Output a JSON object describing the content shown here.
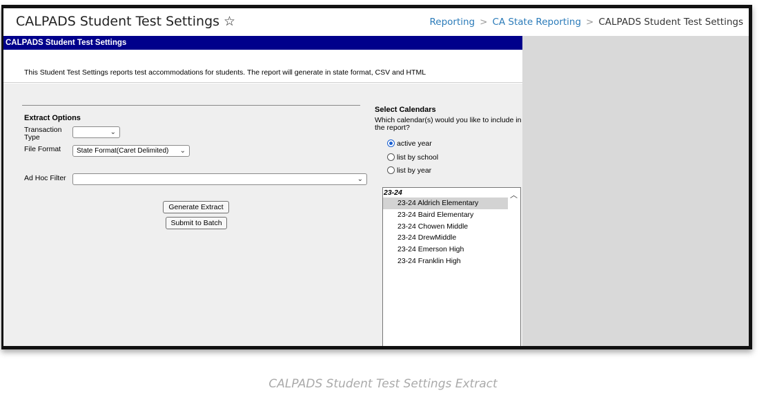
{
  "page": {
    "title": "CALPADS Student Test Settings",
    "star_icon": "star-outline-icon",
    "breadcrumbs": [
      "Reporting",
      "CA State Reporting",
      "CALPADS Student Test Settings"
    ],
    "breadcrumb_separator": ">"
  },
  "panel": {
    "header": "CALPADS Student Test Settings",
    "description": "This Student Test Settings reports test accommodations for students. The report will generate in state format, CSV and HTML"
  },
  "extract": {
    "section_title": "Extract Options",
    "transaction_type_label": "Transaction Type",
    "transaction_type_value": "",
    "file_format_label": "File Format",
    "file_format_value": "State Format(Caret Delimited)",
    "adhoc_label": "Ad Hoc Filter",
    "adhoc_value": "",
    "generate_button": "Generate Extract",
    "batch_button": "Submit to Batch"
  },
  "calendars": {
    "title": "Select Calendars",
    "question": "Which calendar(s) would you like to include in the report?",
    "options": [
      "active year",
      "list by school",
      "list by year"
    ],
    "selected_option": "active year",
    "group_label": "23-24",
    "items": [
      "23-24 Aldrich Elementary",
      "23-24 Baird Elementary",
      "23-24 Chowen Middle",
      "23-24 DrewMiddle",
      "23-24 Emerson High",
      "23-24 Franklin High"
    ],
    "selected_item": "23-24 Aldrich Elementary"
  },
  "caption": "CALPADS Student Test Settings Extract",
  "colors": {
    "header_bg": "#00008b",
    "link": "#2b7bb9",
    "radio_selected": "#1a5fd0"
  }
}
